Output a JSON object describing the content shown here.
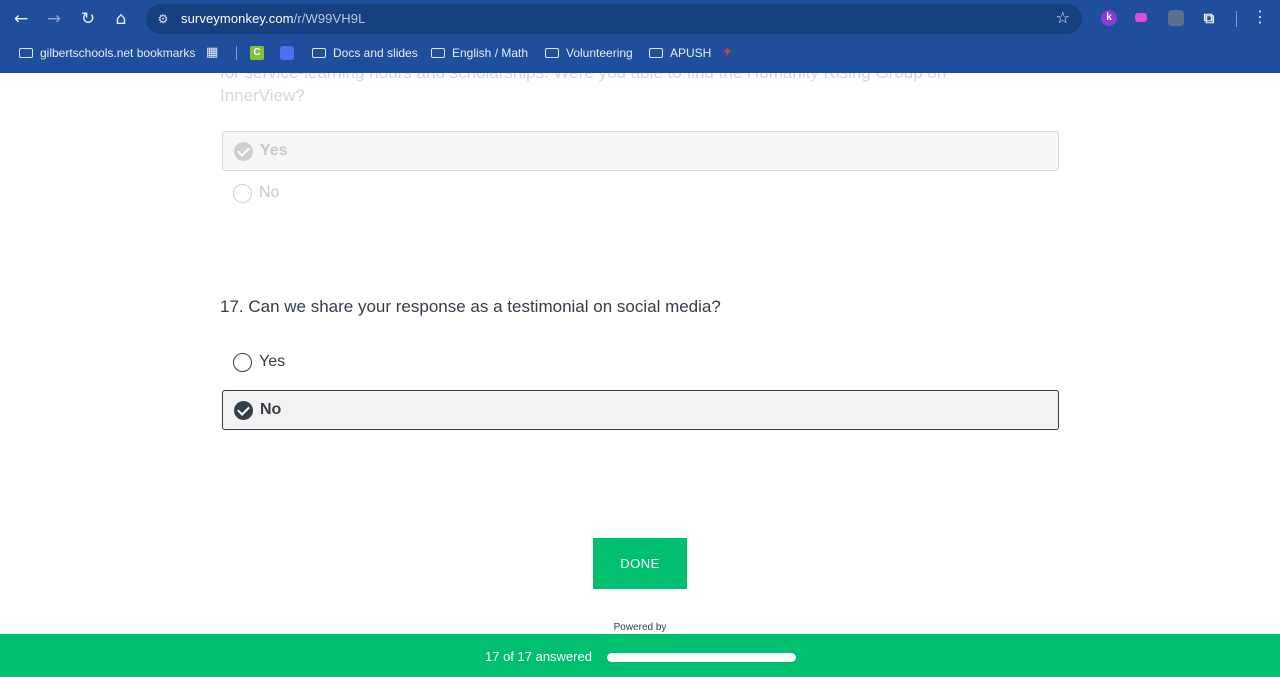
{
  "browser": {
    "url_domain": "surveymonkey.com",
    "url_path": "/r/W99VH9L",
    "bookmarks": [
      {
        "label": "gilbertschools.net bookmarks"
      },
      {
        "label": "Docs and slides"
      },
      {
        "label": "English / Math"
      },
      {
        "label": "Volunteering"
      },
      {
        "label": "APUSH"
      }
    ],
    "extensions": {
      "k_label": "k",
      "c_label": "C"
    }
  },
  "survey": {
    "q16": {
      "text": "for service-learning hours and scholarships. Were you able to find the Humanity Rising Group on InnerView?",
      "options": [
        {
          "label": "Yes",
          "selected": true
        },
        {
          "label": "No",
          "selected": false
        }
      ]
    },
    "q17": {
      "title": "17. Can we share your response as a testimonial on social media?",
      "options": [
        {
          "label": "Yes",
          "selected": false
        },
        {
          "label": "No",
          "selected": true
        }
      ]
    },
    "done_label": "DONE",
    "powered_by": "Powered by"
  },
  "progress": {
    "label": "17 of 17 answered",
    "answered": 17,
    "total": 17,
    "fraction": 1.0
  },
  "colors": {
    "chrome": "#1f4f9c",
    "accent": "#00bf6f",
    "text": "#333e48"
  }
}
